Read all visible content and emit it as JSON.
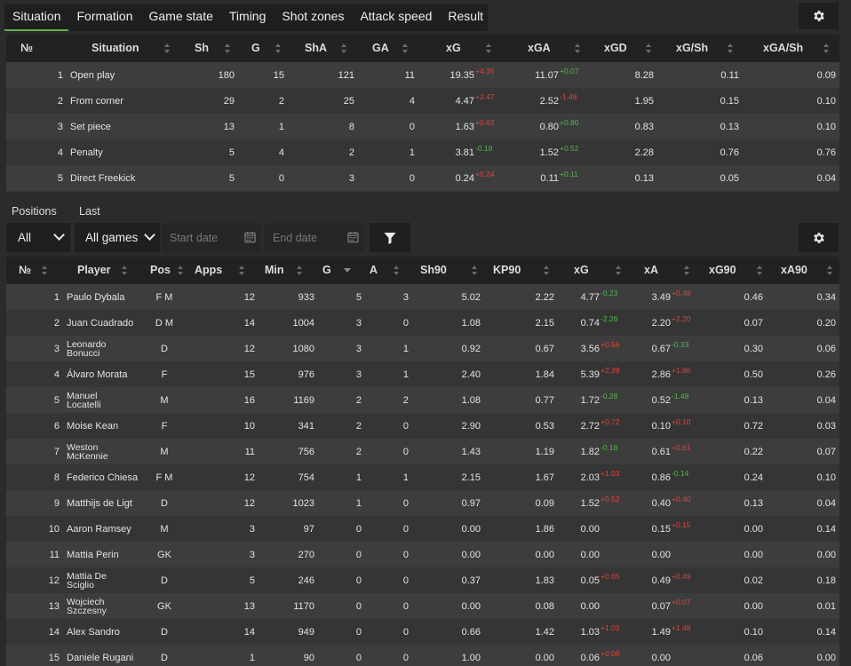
{
  "tabs": [
    "Situation",
    "Formation",
    "Game state",
    "Timing",
    "Shot zones",
    "Attack speed",
    "Result"
  ],
  "colors": {
    "accent": "#5fb24a",
    "up": "#52b84a",
    "down": "#e0443b",
    "header_bg": "#222222",
    "row_odd": "#3d3d3d",
    "row_even": "#353535"
  },
  "icons": {
    "settings": "gear-icon",
    "filter": "funnel-icon",
    "calendar": "calendar-icon",
    "dropdown": "chevron-down-icon",
    "sort": "sort-icon"
  },
  "situation_table": {
    "headers": [
      "№",
      "Situation",
      "Sh",
      "G",
      "ShA",
      "GA",
      "xG",
      "xGA",
      "xGD",
      "xG/Sh",
      "xGA/Sh"
    ],
    "rows": [
      {
        "n": "1",
        "situation": "Open play",
        "sh": "180",
        "g": "15",
        "sha": "121",
        "ga": "11",
        "xg": "19.35",
        "xg_d": "+4.35",
        "xg_dir": "dn",
        "xga": "11.07",
        "xga_d": "+0.07",
        "xga_dir": "up",
        "xgd": "8.28",
        "xgsh": "0.11",
        "xgash": "0.09"
      },
      {
        "n": "2",
        "situation": "From corner",
        "sh": "29",
        "g": "2",
        "sha": "25",
        "ga": "4",
        "xg": "4.47",
        "xg_d": "+2.47",
        "xg_dir": "dn",
        "xga": "2.52",
        "xga_d": "-1.48",
        "xga_dir": "dn",
        "xgd": "1.95",
        "xgsh": "0.15",
        "xgash": "0.10"
      },
      {
        "n": "3",
        "situation": "Set piece",
        "sh": "13",
        "g": "1",
        "sha": "8",
        "ga": "0",
        "xg": "1.63",
        "xg_d": "+0.63",
        "xg_dir": "dn",
        "xga": "0.80",
        "xga_d": "+0.80",
        "xga_dir": "up",
        "xgd": "0.83",
        "xgsh": "0.13",
        "xgash": "0.10"
      },
      {
        "n": "4",
        "situation": "Penalty",
        "sh": "5",
        "g": "4",
        "sha": "2",
        "ga": "1",
        "xg": "3.81",
        "xg_d": "-0.19",
        "xg_dir": "up",
        "xga": "1.52",
        "xga_d": "+0.52",
        "xga_dir": "up",
        "xgd": "2.28",
        "xgsh": "0.76",
        "xgash": "0.76"
      },
      {
        "n": "5",
        "situation": "Direct Freekick",
        "sh": "5",
        "g": "0",
        "sha": "3",
        "ga": "0",
        "xg": "0.24",
        "xg_d": "+0.24",
        "xg_dir": "dn",
        "xga": "0.11",
        "xga_d": "+0.11",
        "xga_dir": "up",
        "xgd": "0.13",
        "xgsh": "0.05",
        "xgash": "0.04"
      }
    ]
  },
  "filters": {
    "positions_label": "Positions",
    "last_label": "Last",
    "positions_value": "All",
    "games_value": "All games",
    "start_placeholder": "Start date",
    "end_placeholder": "End date"
  },
  "players_table": {
    "headers": [
      "№",
      "Player",
      "Pos",
      "Apps",
      "Min",
      "G",
      "A",
      "Sh90",
      "KP90",
      "xG",
      "xA",
      "xG90",
      "xA90"
    ],
    "rows": [
      {
        "n": "1",
        "name1": "Paulo Dybala",
        "name2": "",
        "pos": "F M",
        "apps": "12",
        "min": "933",
        "g": "5",
        "a": "3",
        "sh90": "5.02",
        "kp90": "2.22",
        "xg": "4.77",
        "xg_d": "-0.23",
        "xg_dir": "up",
        "xa": "3.49",
        "xa_d": "+0.49",
        "xa_dir": "dn",
        "xg90": "0.46",
        "xa90": "0.34"
      },
      {
        "n": "2",
        "name1": "Juan Cuadrado",
        "name2": "",
        "pos": "D M",
        "apps": "14",
        "min": "1004",
        "g": "3",
        "a": "0",
        "sh90": "1.08",
        "kp90": "2.15",
        "xg": "0.74",
        "xg_d": "-2.26",
        "xg_dir": "up",
        "xa": "2.20",
        "xa_d": "+2.20",
        "xa_dir": "dn",
        "xg90": "0.07",
        "xa90": "0.20"
      },
      {
        "n": "3",
        "name1": "Leonardo",
        "name2": "Bonucci",
        "pos": "D",
        "apps": "12",
        "min": "1080",
        "g": "3",
        "a": "1",
        "sh90": "0.92",
        "kp90": "0.67",
        "xg": "3.56",
        "xg_d": "+0.56",
        "xg_dir": "dn",
        "xa": "0.67",
        "xa_d": "-0.33",
        "xa_dir": "up",
        "xg90": "0.30",
        "xa90": "0.06"
      },
      {
        "n": "4",
        "name1": "Álvaro Morata",
        "name2": "",
        "pos": "F",
        "apps": "15",
        "min": "976",
        "g": "3",
        "a": "1",
        "sh90": "2.40",
        "kp90": "1.84",
        "xg": "5.39",
        "xg_d": "+2.39",
        "xg_dir": "dn",
        "xa": "2.86",
        "xa_d": "+1.86",
        "xa_dir": "dn",
        "xg90": "0.50",
        "xa90": "0.26"
      },
      {
        "n": "5",
        "name1": "Manuel",
        "name2": "Locatelli",
        "pos": "M",
        "apps": "16",
        "min": "1169",
        "g": "2",
        "a": "2",
        "sh90": "1.08",
        "kp90": "0.77",
        "xg": "1.72",
        "xg_d": "-0.28",
        "xg_dir": "up",
        "xa": "0.52",
        "xa_d": "-1.48",
        "xa_dir": "up",
        "xg90": "0.13",
        "xa90": "0.04"
      },
      {
        "n": "6",
        "name1": "Moise Kean",
        "name2": "",
        "pos": "F",
        "apps": "10",
        "min": "341",
        "g": "2",
        "a": "0",
        "sh90": "2.90",
        "kp90": "0.53",
        "xg": "2.72",
        "xg_d": "+0.72",
        "xg_dir": "dn",
        "xa": "0.10",
        "xa_d": "+0.10",
        "xa_dir": "dn",
        "xg90": "0.72",
        "xa90": "0.03"
      },
      {
        "n": "7",
        "name1": "Weston",
        "name2": "McKennie",
        "pos": "M",
        "apps": "11",
        "min": "756",
        "g": "2",
        "a": "0",
        "sh90": "1.43",
        "kp90": "1.19",
        "xg": "1.82",
        "xg_d": "-0.18",
        "xg_dir": "up",
        "xa": "0.61",
        "xa_d": "+0.61",
        "xa_dir": "dn",
        "xg90": "0.22",
        "xa90": "0.07"
      },
      {
        "n": "8",
        "name1": "Federico Chiesa",
        "name2": "",
        "pos": "F M",
        "apps": "12",
        "min": "754",
        "g": "1",
        "a": "1",
        "sh90": "2.15",
        "kp90": "1.67",
        "xg": "2.03",
        "xg_d": "+1.03",
        "xg_dir": "dn",
        "xa": "0.86",
        "xa_d": "-0.14",
        "xa_dir": "up",
        "xg90": "0.24",
        "xa90": "0.10"
      },
      {
        "n": "9",
        "name1": "Matthijs de Ligt",
        "name2": "",
        "pos": "D",
        "apps": "12",
        "min": "1023",
        "g": "1",
        "a": "0",
        "sh90": "0.97",
        "kp90": "0.09",
        "xg": "1.52",
        "xg_d": "+0.52",
        "xg_dir": "dn",
        "xa": "0.40",
        "xa_d": "+0.40",
        "xa_dir": "dn",
        "xg90": "0.13",
        "xa90": "0.04"
      },
      {
        "n": "10",
        "name1": "Aaron Ramsey",
        "name2": "",
        "pos": "M",
        "apps": "3",
        "min": "97",
        "g": "0",
        "a": "0",
        "sh90": "0.00",
        "kp90": "1.86",
        "xg": "0.00",
        "xg_d": "",
        "xg_dir": "",
        "xa": "0.15",
        "xa_d": "+0.15",
        "xa_dir": "dn",
        "xg90": "0.00",
        "xa90": "0.14"
      },
      {
        "n": "11",
        "name1": "Mattia Perin",
        "name2": "",
        "pos": "GK",
        "apps": "3",
        "min": "270",
        "g": "0",
        "a": "0",
        "sh90": "0.00",
        "kp90": "0.00",
        "xg": "0.00",
        "xg_d": "",
        "xg_dir": "",
        "xa": "0.00",
        "xa_d": "",
        "xa_dir": "",
        "xg90": "0.00",
        "xa90": "0.00"
      },
      {
        "n": "12",
        "name1": "Mattia De",
        "name2": "Sciglio",
        "pos": "D",
        "apps": "5",
        "min": "246",
        "g": "0",
        "a": "0",
        "sh90": "0.37",
        "kp90": "1.83",
        "xg": "0.05",
        "xg_d": "+0.05",
        "xg_dir": "dn",
        "xa": "0.49",
        "xa_d": "+0.49",
        "xa_dir": "dn",
        "xg90": "0.02",
        "xa90": "0.18"
      },
      {
        "n": "13",
        "name1": "Wojciech",
        "name2": "Szczesny",
        "pos": "GK",
        "apps": "13",
        "min": "1170",
        "g": "0",
        "a": "0",
        "sh90": "0.00",
        "kp90": "0.08",
        "xg": "0.00",
        "xg_d": "",
        "xg_dir": "",
        "xa": "0.07",
        "xa_d": "+0.07",
        "xa_dir": "dn",
        "xg90": "0.00",
        "xa90": "0.01"
      },
      {
        "n": "14",
        "name1": "Alex Sandro",
        "name2": "",
        "pos": "D",
        "apps": "14",
        "min": "949",
        "g": "0",
        "a": "0",
        "sh90": "0.66",
        "kp90": "1.42",
        "xg": "1.03",
        "xg_d": "+1.03",
        "xg_dir": "dn",
        "xa": "1.49",
        "xa_d": "+1.48",
        "xa_dir": "dn",
        "xg90": "0.10",
        "xa90": "0.14"
      },
      {
        "n": "15",
        "name1": "Daniele Rugani",
        "name2": "",
        "pos": "D",
        "apps": "1",
        "min": "90",
        "g": "0",
        "a": "0",
        "sh90": "1.00",
        "kp90": "0.00",
        "xg": "0.06",
        "xg_d": "+0.06",
        "xg_dir": "dn",
        "xa": "0.00",
        "xa_d": "",
        "xa_dir": "",
        "xg90": "0.06",
        "xa90": "0.00"
      }
    ]
  }
}
